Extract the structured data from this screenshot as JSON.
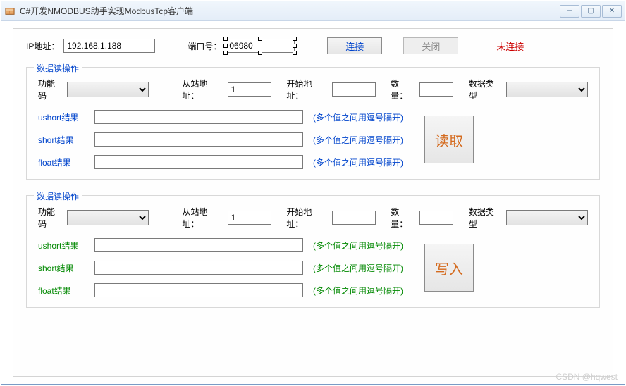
{
  "window": {
    "title": "C#开发NMODBUS助手实现ModbusTcp客户端"
  },
  "connection": {
    "ip_label": "IP地址：",
    "ip_value": "192.168.1.188",
    "port_label": "端口号：",
    "port_value": "06980",
    "connect_btn": "连接",
    "close_btn": "关闭",
    "status": "未连接"
  },
  "read_group": {
    "title": "数据读操作",
    "funccode_label": "功能码",
    "slave_label": "从站地址：",
    "slave_value": "1",
    "start_label": "开始地址：",
    "start_value": "",
    "count_label": "数量：",
    "count_value": "",
    "datatype_label": "数据类型",
    "ushort_label": "ushort结果",
    "short_label": "short结果",
    "float_label": "float结果",
    "hint": "(多个值之间用逗号隔开)",
    "action_btn": "读取"
  },
  "write_group": {
    "title": "数据读操作",
    "funccode_label": "功能码",
    "slave_label": "从站地址：",
    "slave_value": "1",
    "start_label": "开始地址：",
    "start_value": "",
    "count_label": "数量：",
    "count_value": "",
    "datatype_label": "数据类型",
    "ushort_label": "ushort结果",
    "short_label": "short结果",
    "float_label": "float结果",
    "hint": "(多个值之间用逗号隔开)",
    "action_btn": "写入"
  },
  "watermark": "CSDN @hqwest"
}
